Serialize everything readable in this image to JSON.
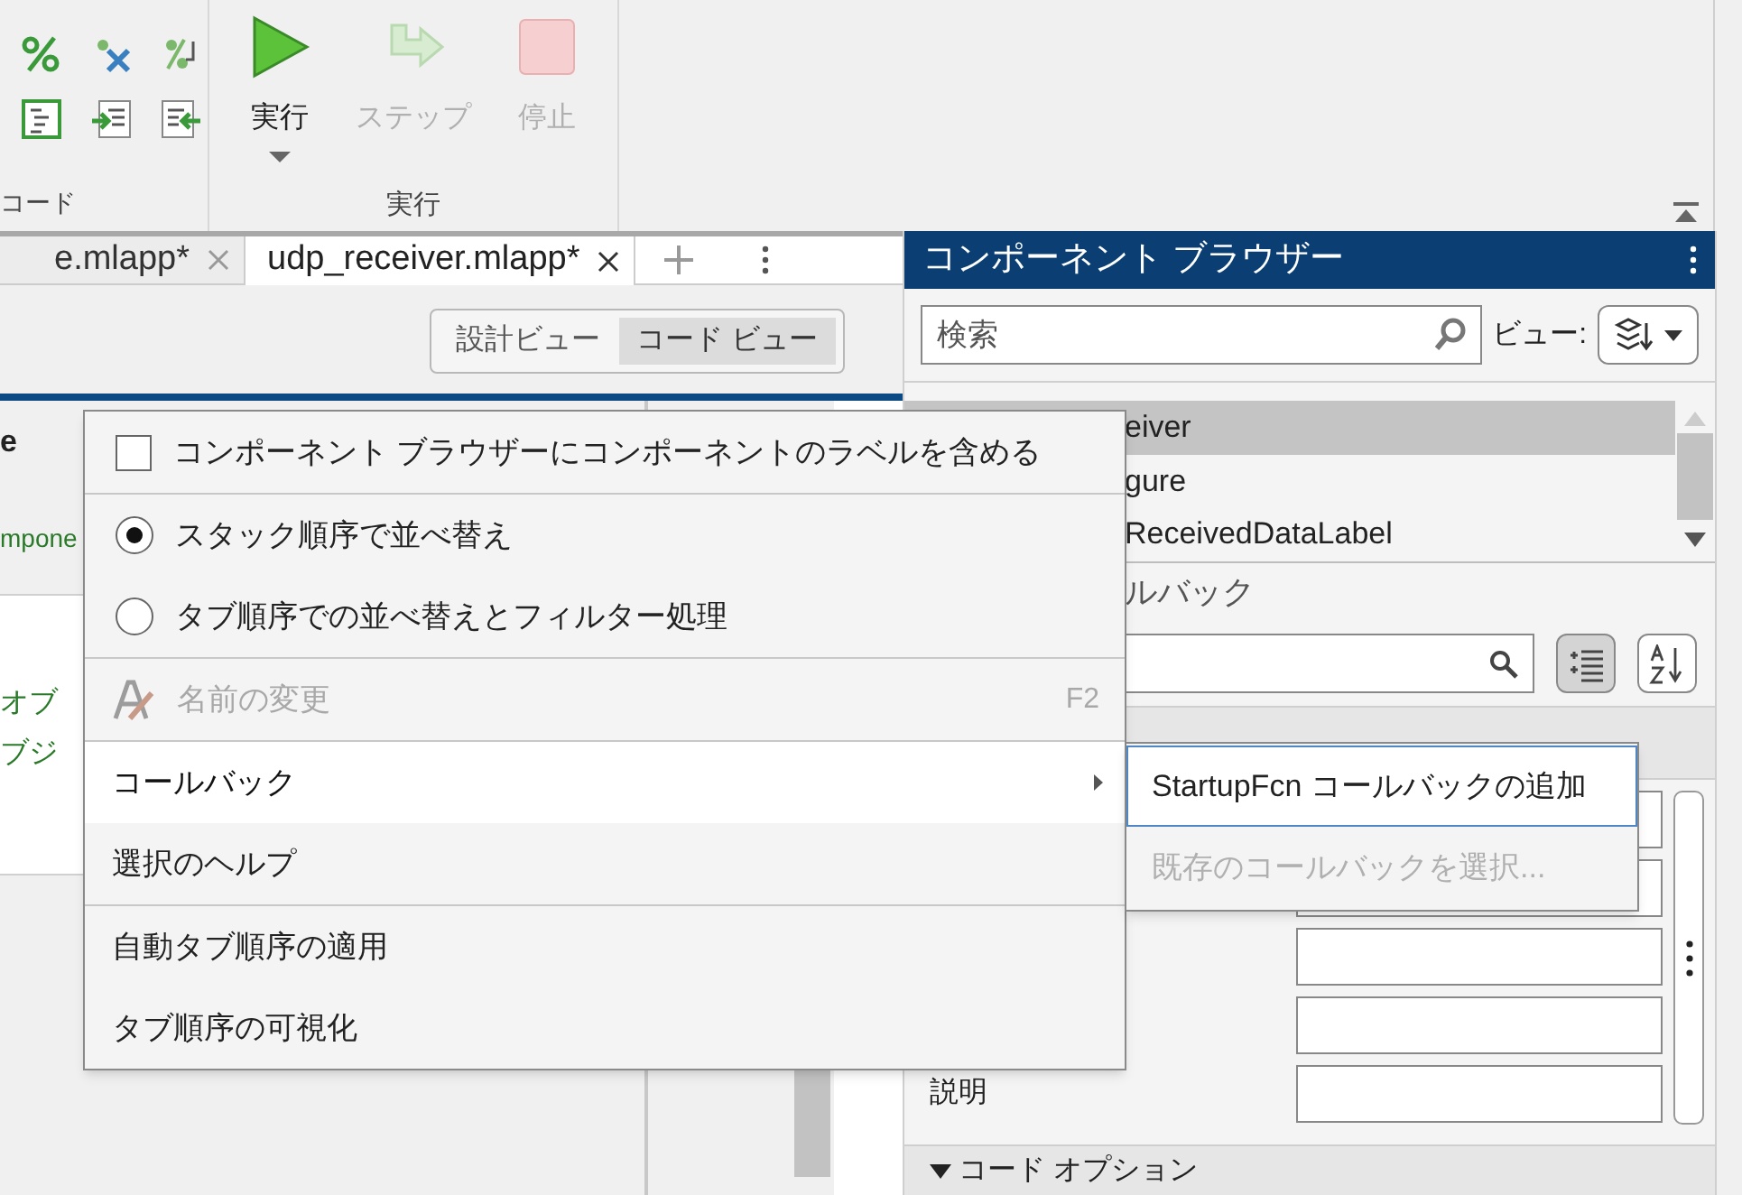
{
  "toolbar": {
    "code_group": {
      "label": "コード"
    },
    "run_group": {
      "label": "実行",
      "buttons": [
        {
          "label": "実行",
          "kind": "run",
          "disabled": false
        },
        {
          "label": "ステップ",
          "kind": "step",
          "disabled": true
        },
        {
          "label": "停止",
          "kind": "stop",
          "disabled": true
        }
      ]
    }
  },
  "tabs": [
    {
      "label": "e.mlapp*",
      "selected": false
    },
    {
      "label": "udp_receiver.mlapp*",
      "selected": true
    }
  ],
  "view_toggle": [
    {
      "label": "設計ビュー",
      "selected": false
    },
    {
      "label": "コード ビュー",
      "selected": true
    }
  ],
  "code_browser": {
    "title_fragment": "e",
    "item_fragment": "mpone",
    "comment_lines": [
      "オブ",
      "ブジ"
    ]
  },
  "component_browser": {
    "title": "コンポーネント ブラウザー",
    "search": {
      "placeholder": "検索"
    },
    "view_label": "ビュー:",
    "tree": [
      {
        "label": "eiver",
        "selected": true
      },
      {
        "label": "gure",
        "selected": false
      },
      {
        "label": "ReceivedDataLabel",
        "selected": false
      }
    ],
    "callbacks_title": "ルバック",
    "description_label": "説明",
    "code_options": {
      "label": "コード オプション",
      "expanded": true
    }
  },
  "context_menu": [
    {
      "kind": "checkbox",
      "label": "コンポーネント ブラウザーにコンポーネントのラベルを含める",
      "checked": false
    },
    {
      "kind": "separator"
    },
    {
      "kind": "radio",
      "label": "スタック順序で並べ替え",
      "selected": true
    },
    {
      "kind": "radio",
      "label": "タブ順序での並べ替えとフィルター処理",
      "selected": false
    },
    {
      "kind": "separator"
    },
    {
      "kind": "action",
      "label": "名前の変更",
      "shortcut": "F2",
      "disabled": true,
      "icon": true
    },
    {
      "kind": "separator"
    },
    {
      "kind": "submenu",
      "label": "コールバック",
      "highlighted": true
    },
    {
      "kind": "action",
      "label": "選択のヘルプ",
      "disabled": false
    },
    {
      "kind": "separator"
    },
    {
      "kind": "action",
      "label": "自動タブ順序の適用",
      "disabled": false
    },
    {
      "kind": "action",
      "label": "タブ順序の可視化",
      "disabled": false
    }
  ],
  "submenu": [
    {
      "label": "StartupFcn コールバックの追加",
      "disabled": false,
      "focused": true
    },
    {
      "label": "既存のコールバックを選択...",
      "disabled": true,
      "focused": false
    }
  ]
}
